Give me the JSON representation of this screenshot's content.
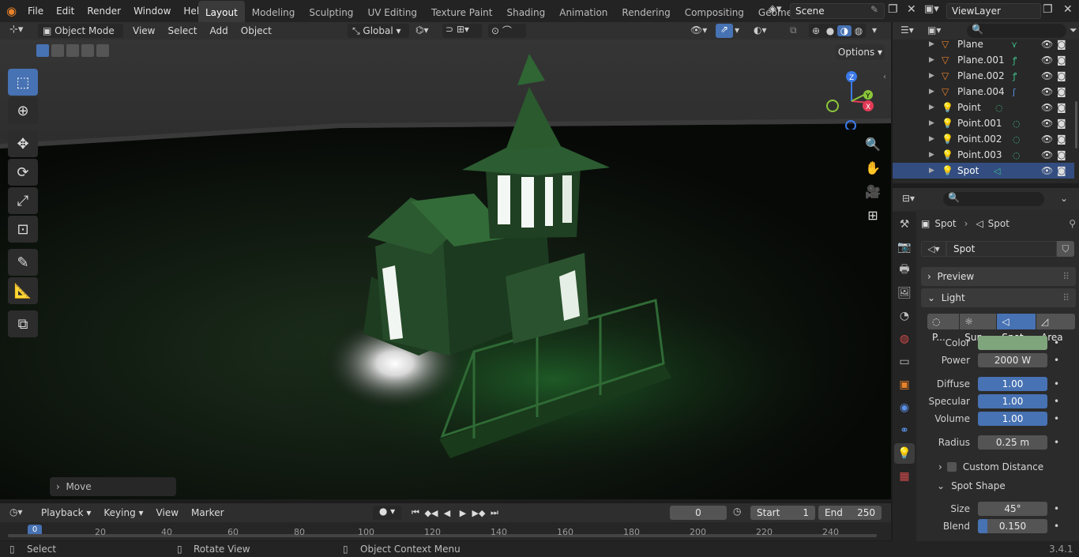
{
  "topbar": {
    "menus": [
      "File",
      "Edit",
      "Render",
      "Window",
      "Help"
    ],
    "workspaces": [
      "Layout",
      "Modeling",
      "Sculpting",
      "UV Editing",
      "Texture Paint",
      "Shading",
      "Animation",
      "Rendering",
      "Compositing",
      "Geometry Node"
    ],
    "active_workspace": "Layout",
    "scene": "Scene",
    "view_layer": "ViewLayer"
  },
  "viewport_header": {
    "mode": "Object Mode",
    "menus": [
      "View",
      "Select",
      "Add",
      "Object"
    ],
    "orientation": "Global",
    "options": "Options"
  },
  "viewport": {
    "last_op": "Move",
    "gizmo": {
      "x": "X",
      "y": "Y",
      "z": "Z"
    }
  },
  "outliner": {
    "items": [
      {
        "name": "Plane",
        "type": "mesh"
      },
      {
        "name": "Plane.001",
        "type": "mesh"
      },
      {
        "name": "Plane.002",
        "type": "mesh"
      },
      {
        "name": "Plane.004",
        "type": "mesh"
      },
      {
        "name": "Point",
        "type": "light"
      },
      {
        "name": "Point.001",
        "type": "light"
      },
      {
        "name": "Point.002",
        "type": "light"
      },
      {
        "name": "Point.003",
        "type": "light"
      },
      {
        "name": "Spot",
        "type": "light",
        "selected": true
      }
    ]
  },
  "properties": {
    "breadcrumb_object": "Spot",
    "breadcrumb_data": "Spot",
    "datablock": "Spot",
    "preview_label": "Preview",
    "light_label": "Light",
    "light_types": [
      "P...",
      "Sun",
      "Spot",
      "Area"
    ],
    "active_type": "Spot",
    "color_label": "Color",
    "color_value": "#7fa57c",
    "power_label": "Power",
    "power": "2000 W",
    "diffuse_label": "Diffuse",
    "diffuse": "1.00",
    "specular_label": "Specular",
    "specular": "1.00",
    "volume_label": "Volume",
    "volume": "1.00",
    "radius_label": "Radius",
    "radius": "0.25 m",
    "custom_distance": "Custom Distance",
    "spot_shape": "Spot Shape",
    "size_label": "Size",
    "size": "45°",
    "blend_label": "Blend",
    "blend": "0.150"
  },
  "timeline": {
    "menus": [
      "Playback",
      "Keying",
      "View",
      "Marker"
    ],
    "current_frame": "0",
    "start_label": "Start",
    "start": "1",
    "end_label": "End",
    "end": "250",
    "ticks": [
      "0",
      "20",
      "40",
      "60",
      "80",
      "100",
      "120",
      "140",
      "160",
      "180",
      "200",
      "220",
      "240"
    ]
  },
  "statusbar": {
    "select": "Select",
    "rotate": "Rotate View",
    "context": "Object Context Menu",
    "version": "3.4.1"
  },
  "colors": {
    "accent": "#4772b3",
    "light_icon": "#3fc48c",
    "mesh_icon": "#e8822a"
  }
}
